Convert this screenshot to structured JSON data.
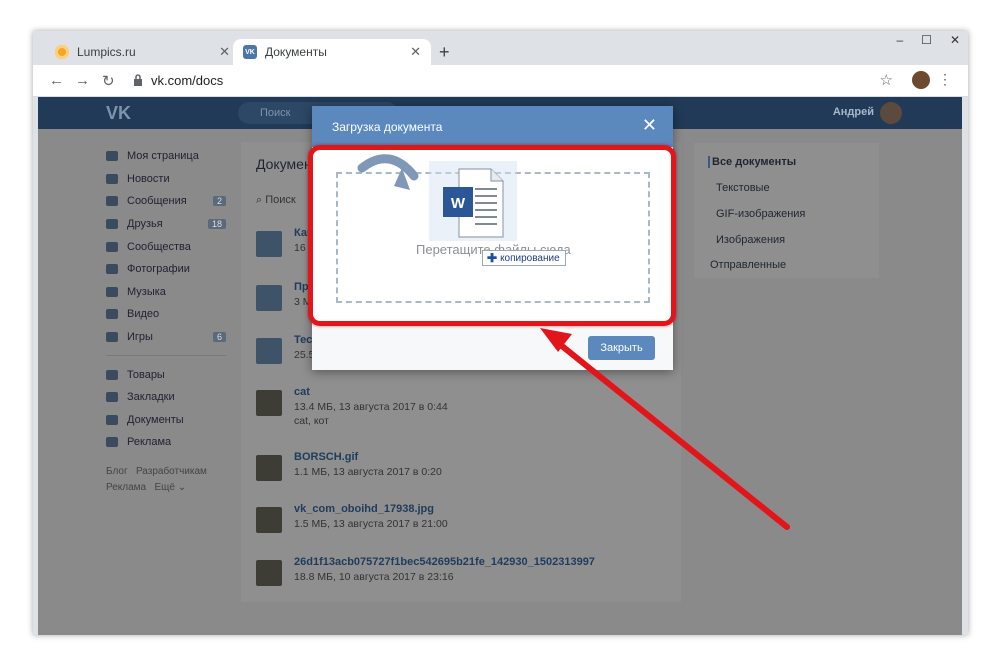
{
  "browser": {
    "tabs": [
      {
        "title": "Lumpics.ru"
      },
      {
        "title": "Документы"
      }
    ],
    "url": "vk.com/docs",
    "window_controls": [
      "–",
      "☐",
      "✕"
    ]
  },
  "vk": {
    "logo": "VK",
    "search_placeholder": "Поиск",
    "user_name": "Андрей",
    "left_nav": [
      {
        "label": "Моя страница",
        "icon": "home-icon"
      },
      {
        "label": "Новости",
        "icon": "news-icon"
      },
      {
        "label": "Сообщения",
        "icon": "messages-icon",
        "badge": "2"
      },
      {
        "label": "Друзья",
        "icon": "friends-icon",
        "badge": "18"
      },
      {
        "label": "Сообщества",
        "icon": "communities-icon"
      },
      {
        "label": "Фотографии",
        "icon": "camera-icon"
      },
      {
        "label": "Музыка",
        "icon": "music-icon"
      },
      {
        "label": "Видео",
        "icon": "video-icon"
      },
      {
        "label": "Игры",
        "icon": "games-icon",
        "badge": "6"
      }
    ],
    "left_nav_2": [
      {
        "label": "Товары",
        "icon": "goods-icon"
      },
      {
        "label": "Закладки",
        "icon": "bookmarks-icon"
      },
      {
        "label": "Документы",
        "icon": "documents-icon"
      },
      {
        "label": "Реклама",
        "icon": "ads-icon"
      }
    ],
    "footer_links": {
      "blog": "Блог",
      "dev": "Разработчикам",
      "ads": "Реклама",
      "more": "Ещё ⌄"
    },
    "content_title": "Докумен",
    "content_search": "Поиск",
    "docs": [
      {
        "name": "Как",
        "meta": "16 ",
        "tags": "",
        "thumb": "doc"
      },
      {
        "name": "Про",
        "meta": "3 М",
        "tags": "",
        "thumb": "doc"
      },
      {
        "name": "Тест",
        "meta": "25.5",
        "tags": "",
        "thumb": "doc"
      },
      {
        "name": "cat",
        "meta": "13.4 МБ, 13 августа 2017 в 0:44",
        "tags": "cat, кот",
        "thumb": "photo"
      },
      {
        "name": "BORSCH.gif",
        "meta": "1.1 МБ, 13 августа 2017 в 0:20",
        "tags": "",
        "thumb": "photo"
      },
      {
        "name": "vk_com_oboihd_17938.jpg",
        "meta": "1.5 МБ, 13 августа 2017 в 21:00",
        "tags": "",
        "thumb": "photo"
      },
      {
        "name": "26d1f13acb075727f1bec542695b21fe_142930_1502313997",
        "meta": "18.8 МБ, 10 августа 2017 в 23:16",
        "tags": "",
        "thumb": "photo"
      }
    ],
    "right_nav": {
      "all": "Все документы",
      "text": "Текстовые",
      "gif": "GIF-изображения",
      "images": "Изображения",
      "sent": "Отправленные"
    }
  },
  "modal": {
    "title": "Загрузка документа",
    "drop_text": "Перетащите файлы сюда",
    "close_button": "Закрыть",
    "drag_tooltip": "копирование",
    "drag_file_icon": "W"
  },
  "colors": {
    "vk_blue": "#5b88bd",
    "highlight_red": "#e2151b"
  }
}
